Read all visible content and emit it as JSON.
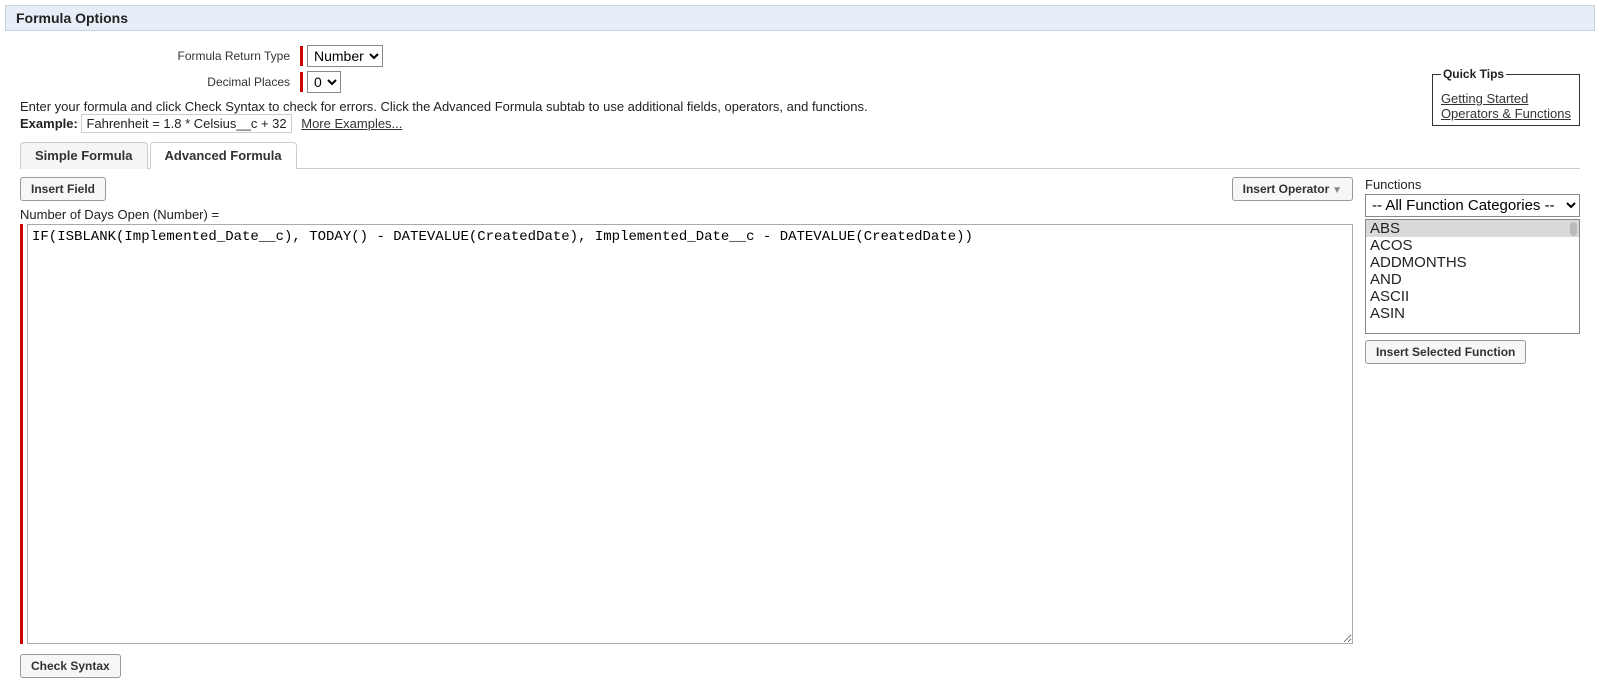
{
  "header": {
    "title": "Formula Options"
  },
  "form": {
    "return_type_label": "Formula Return Type",
    "return_type_value": "Number",
    "decimal_label": "Decimal Places",
    "decimal_value": "0"
  },
  "instruction": "Enter your formula and click Check Syntax to check for errors. Click the Advanced Formula subtab to use additional fields, operators, and functions.",
  "example": {
    "label": "Example:",
    "code": "Fahrenheit = 1.8 * Celsius__c + 32",
    "more": "More Examples..."
  },
  "tabs": {
    "simple": "Simple Formula",
    "advanced": "Advanced Formula"
  },
  "toolbar": {
    "insert_field": "Insert Field",
    "insert_operator": "Insert Operator"
  },
  "field_label": "Number of Days Open (Number) =",
  "formula_value": "IF(ISBLANK(Implemented_Date__c), TODAY() - DATEVALUE(CreatedDate), Implemented_Date__c - DATEVALUE(CreatedDate))",
  "functions": {
    "label": "Functions",
    "category": "-- All Function Categories --",
    "items": [
      "ABS",
      "ACOS",
      "ADDMONTHS",
      "AND",
      "ASCII",
      "ASIN"
    ],
    "insert_btn": "Insert Selected Function"
  },
  "check_syntax": "Check Syntax",
  "quick_tips": {
    "title": "Quick Tips",
    "link1": "Getting Started",
    "link2": "Operators & Functions"
  }
}
